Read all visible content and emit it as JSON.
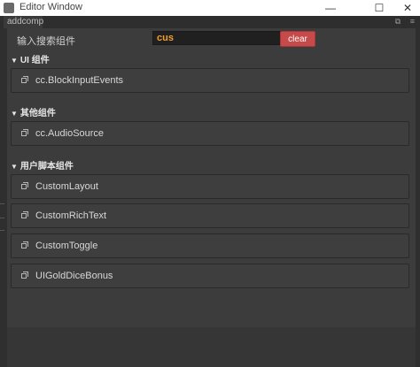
{
  "window": {
    "title": "Editor Window"
  },
  "titlebar_buttons": {
    "minimize": "—",
    "maximize": "☐",
    "close": "✕"
  },
  "tab": {
    "label": "addcomp"
  },
  "search": {
    "label": "输入搜索组件",
    "value": "cus",
    "clear_label": "clear"
  },
  "sections": [
    {
      "title": "UI 组件",
      "items": [
        "cc.BlockInputEvents"
      ]
    },
    {
      "title": "其他组件",
      "items": [
        "cc.AudioSource"
      ]
    },
    {
      "title": "用户脚本组件",
      "items": [
        "CustomLayout",
        "CustomRichText",
        "CustomToggle",
        "UIGoldDiceBonus"
      ]
    }
  ],
  "colors": {
    "input_text": "#f0a030",
    "clear_button": "#c74a4a",
    "background": "#3c3c3c"
  }
}
